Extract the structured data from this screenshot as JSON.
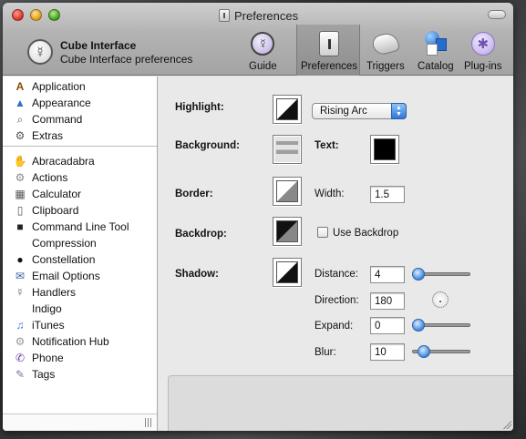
{
  "window": {
    "title": "Preferences"
  },
  "toolbar": {
    "app_name": "Cube Interface",
    "app_subtitle": "Cube Interface preferences",
    "buttons": [
      {
        "label": "Guide",
        "icon": "guide-icon"
      },
      {
        "label": "Preferences",
        "icon": "preferences-icon",
        "selected": true
      },
      {
        "label": "Triggers",
        "icon": "triggers-icon"
      },
      {
        "label": "Catalog",
        "icon": "catalog-icon"
      },
      {
        "label": "Plug-ins",
        "icon": "plugins-icon"
      }
    ]
  },
  "sidebar": {
    "group1": [
      {
        "label": "Application",
        "icon": "application-icon"
      },
      {
        "label": "Appearance",
        "icon": "appearance-icon"
      },
      {
        "label": "Command",
        "icon": "command-icon"
      },
      {
        "label": "Extras",
        "icon": "extras-icon"
      }
    ],
    "group2": [
      {
        "label": "Abracadabra",
        "icon": "abracadabra-icon"
      },
      {
        "label": "Actions",
        "icon": "actions-icon"
      },
      {
        "label": "Calculator",
        "icon": "calculator-icon"
      },
      {
        "label": "Clipboard",
        "icon": "clipboard-icon"
      },
      {
        "label": "Command Line Tool",
        "icon": "terminal-icon"
      },
      {
        "label": "Compression",
        "icon": ""
      },
      {
        "label": "Constellation",
        "icon": "constellation-icon"
      },
      {
        "label": "Email Options",
        "icon": "email-icon"
      },
      {
        "label": "Handlers",
        "icon": "handlers-icon"
      },
      {
        "label": "Indigo",
        "icon": ""
      },
      {
        "label": "iTunes",
        "icon": "itunes-icon"
      },
      {
        "label": "Notification Hub",
        "icon": "notification-icon"
      },
      {
        "label": "Phone",
        "icon": "phone-icon"
      },
      {
        "label": "Tags",
        "icon": "tags-icon"
      }
    ]
  },
  "form": {
    "highlight_label": "Highlight:",
    "highlight_style": "Rising Arc",
    "background_label": "Background:",
    "text_label": "Text:",
    "border_label": "Border:",
    "width_label": "Width:",
    "width_value": "1.5",
    "backdrop_label": "Backdrop:",
    "use_backdrop_label": "Use Backdrop",
    "use_backdrop_checked": false,
    "shadow_label": "Shadow:",
    "distance_label": "Distance:",
    "distance_value": "4",
    "direction_label": "Direction:",
    "direction_value": "180",
    "expand_label": "Expand:",
    "expand_value": "0",
    "blur_label": "Blur:",
    "blur_value": "10"
  },
  "colors": {
    "accent": "#3f88dc"
  }
}
